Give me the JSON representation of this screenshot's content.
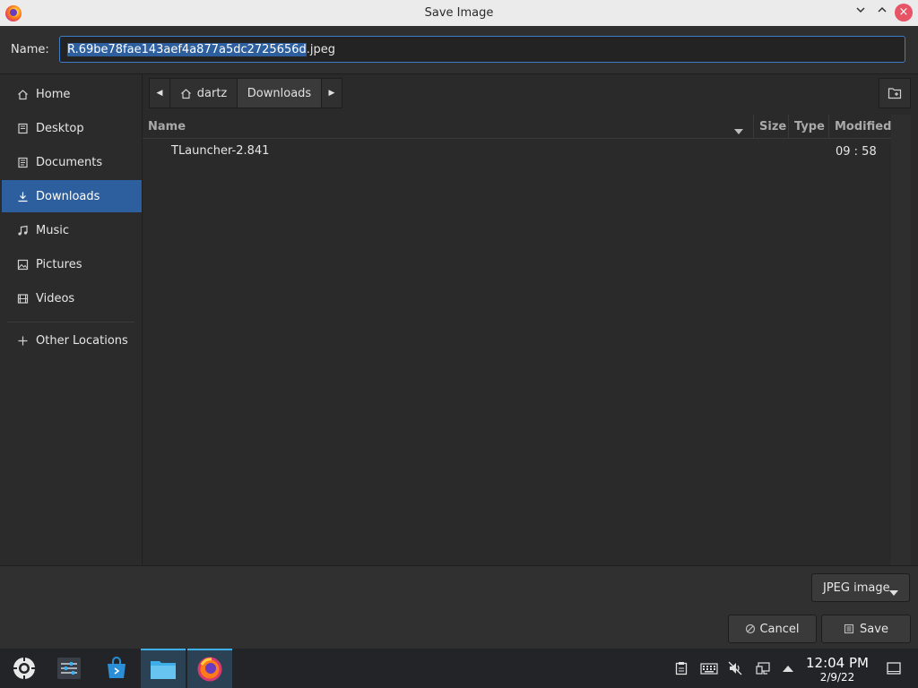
{
  "window": {
    "title": "Save Image",
    "minimize_icon": "chevron-down",
    "maximize_icon": "chevron-up",
    "close_icon": "×",
    "app_icon": "firefox-icon"
  },
  "name_field": {
    "label": "Name:",
    "selected_part": "R.69be78fae143aef4a877a5dc2725656d",
    "extension": ".jpeg"
  },
  "sidebar": {
    "items": [
      {
        "label": "Home",
        "icon": "home-icon"
      },
      {
        "label": "Desktop",
        "icon": "desktop-icon"
      },
      {
        "label": "Documents",
        "icon": "documents-icon"
      },
      {
        "label": "Downloads",
        "icon": "downloads-icon",
        "active": true
      },
      {
        "label": "Music",
        "icon": "music-icon"
      },
      {
        "label": "Pictures",
        "icon": "pictures-icon"
      },
      {
        "label": "Videos",
        "icon": "videos-icon"
      }
    ],
    "other_locations": "Other Locations"
  },
  "pathbar": {
    "back_icon": "◀",
    "segments": [
      "dartz",
      "Downloads"
    ],
    "forward_icon": "▶",
    "new_folder_icon": "new-folder-icon"
  },
  "file_list": {
    "columns": {
      "name": "Name",
      "size": "Size",
      "type": "Type",
      "modified": "Modified"
    },
    "rows": [
      {
        "name": "TLauncher-2.841",
        "size": "",
        "type": "",
        "modified": "09 : 58"
      }
    ]
  },
  "footer": {
    "filter_label": "JPEG image",
    "cancel_label": "Cancel",
    "save_label": "Save"
  },
  "taskbar": {
    "clock_time": "12:04 PM",
    "clock_date": "2/9/22",
    "accent": "#3daee9"
  }
}
